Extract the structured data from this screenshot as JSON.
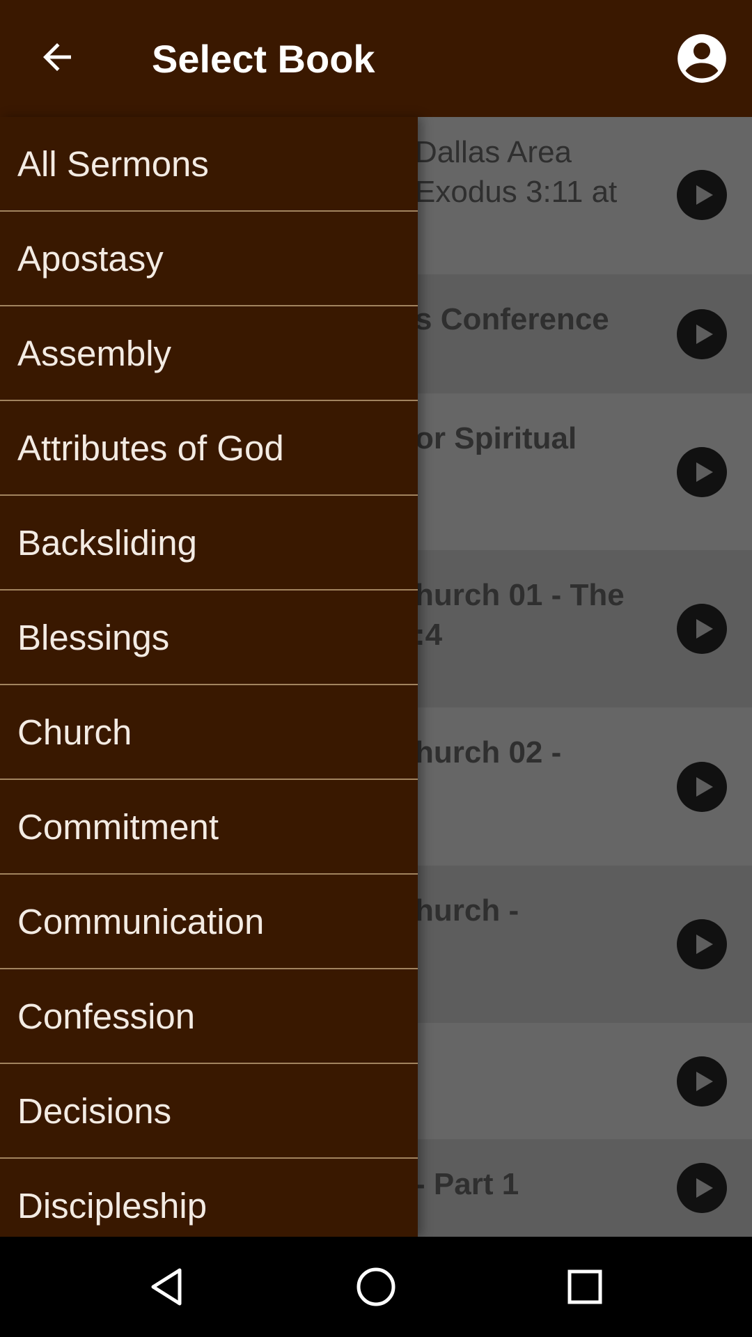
{
  "app_bar": {
    "title": "Select Book",
    "back_icon": "arrow-left-icon",
    "account_icon": "account-circle-icon",
    "color": "#3a1800"
  },
  "background_list": [
    {
      "lines": [
        "Dallas Area",
        "Exodus 3:11 at"
      ],
      "bold": false
    },
    {
      "lines": [
        "s Conference"
      ],
      "bold": true
    },
    {
      "lines": [
        "or Spiritual"
      ],
      "bold": true
    },
    {
      "lines": [
        "hurch 01 - The",
        ":4"
      ],
      "bold": true
    },
    {
      "lines": [
        "hurch 02 -"
      ],
      "bold": true
    },
    {
      "lines": [
        "hurch -"
      ],
      "bold": true
    },
    {
      "lines": [],
      "bold": true
    },
    {
      "lines": [
        "- Part 1"
      ],
      "bold": true
    }
  ],
  "drawer": {
    "color": "#391800",
    "items": [
      {
        "label": "All Sermons"
      },
      {
        "label": "Apostasy"
      },
      {
        "label": "Assembly"
      },
      {
        "label": "Attributes of God"
      },
      {
        "label": "Backsliding"
      },
      {
        "label": "Blessings"
      },
      {
        "label": "Church"
      },
      {
        "label": "Commitment"
      },
      {
        "label": "Communication"
      },
      {
        "label": "Confession"
      },
      {
        "label": "Decisions"
      },
      {
        "label": "Discipleship"
      }
    ]
  },
  "nav_bar": {
    "back_icon": "triangle-back-icon",
    "home_icon": "circle-home-icon",
    "recents_icon": "square-recents-icon"
  }
}
